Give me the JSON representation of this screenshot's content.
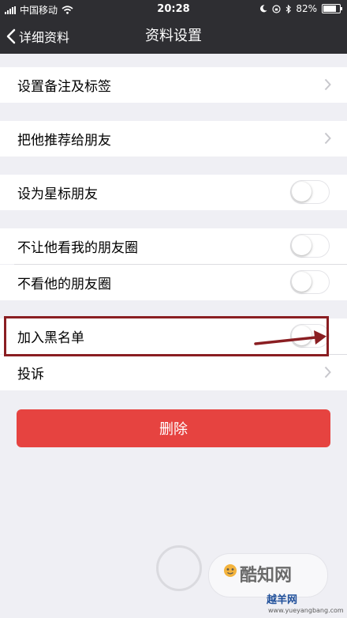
{
  "status_bar": {
    "carrier": "中国移动",
    "time": "20:28",
    "battery": "82%"
  },
  "nav": {
    "back_label": "详细资料",
    "title": "资料设置"
  },
  "rows": {
    "remark": "设置备注及标签",
    "recommend": "把他推荐给朋友",
    "star": "设为星标朋友",
    "hide_moments": "不让他看我的朋友圈",
    "not_see": "不看他的朋友圈",
    "blacklist": "加入黑名单",
    "report": "投诉"
  },
  "delete_label": "删除",
  "watermark": {
    "brand": "酷知网",
    "site": "越羊网",
    "url": "www.yueyangbang.com"
  },
  "colors": {
    "nav_bg": "#2e2e32",
    "page_bg": "#efeff4",
    "delete": "#e64340",
    "highlight": "#8a1e22"
  }
}
